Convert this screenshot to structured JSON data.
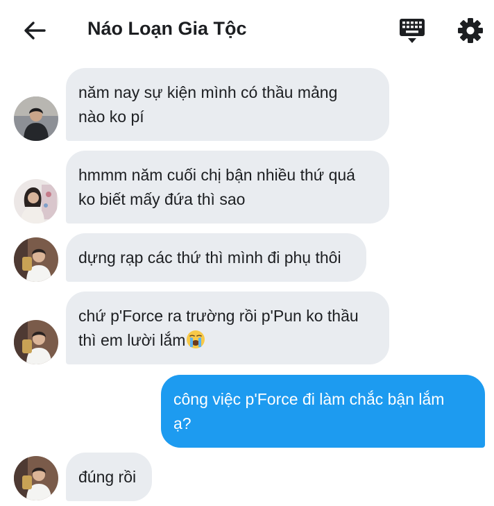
{
  "header": {
    "title": "Náo Loạn Gia Tộc",
    "back_icon": "arrow-left-icon",
    "keyboard_icon": "keyboard-icon",
    "settings_icon": "gear-icon"
  },
  "colors": {
    "incoming_bubble": "#e9ecf0",
    "outgoing_bubble": "#1d9bf0",
    "text": "#1c1e21"
  },
  "messages": [
    {
      "direction": "incoming",
      "sender_avatar": "avatar-boy-dark-jacket",
      "lines": [
        "năm nay sự kiện mình có thầu mảng",
        "nào ko pí"
      ]
    },
    {
      "direction": "incoming",
      "sender_avatar": "avatar-girl",
      "lines": [
        "hmmm năm cuối chị bận nhiều thứ quá",
        "ko biết mấy đứa thì sao"
      ]
    },
    {
      "direction": "incoming",
      "sender_avatar": "avatar-boy-white-shirt",
      "lines": [
        "dựng rạp các thứ thì mình đi phụ thôi"
      ]
    },
    {
      "direction": "incoming",
      "sender_avatar": "avatar-boy-white-shirt",
      "lines": [
        "chứ p'Force ra trường rồi p'Pun ko thầu",
        "thì em lười lắm"
      ],
      "emoji": "loudly-crying-face"
    },
    {
      "direction": "outgoing",
      "lines": [
        "công việc p'Force đi làm chắc bận lắm",
        "ạ?"
      ]
    },
    {
      "direction": "incoming",
      "sender_avatar": "avatar-boy-white-shirt",
      "lines": [
        "đúng rồi"
      ]
    }
  ]
}
